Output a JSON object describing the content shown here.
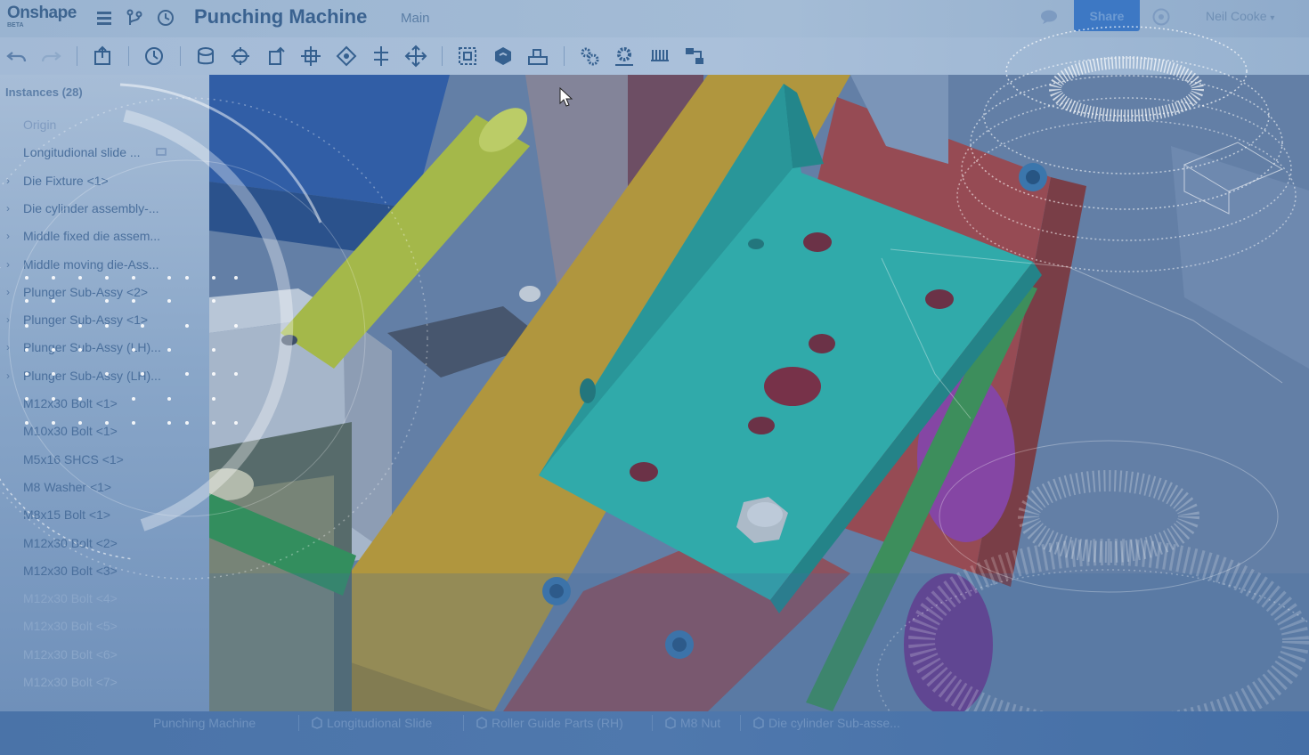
{
  "header": {
    "logo": "Onshape",
    "logo_badge": "BETA",
    "doc_title": "Punching Machine",
    "workspace": "Main",
    "share_label": "Share",
    "user_name": "Neil Cooke"
  },
  "toolbar": {
    "buttons": [
      {
        "icon": "undo-icon"
      },
      {
        "icon": "redo-icon"
      },
      {
        "icon": "export-icon"
      },
      {
        "icon": "history-icon"
      },
      {
        "icon": "insert-part-icon"
      },
      {
        "icon": "fastened-mate-icon"
      },
      {
        "icon": "slider-mate-icon"
      },
      {
        "icon": "revolute-mate-icon"
      },
      {
        "icon": "planar-mate-icon"
      },
      {
        "icon": "cylindrical-mate-icon"
      },
      {
        "icon": "ball-mate-icon"
      },
      {
        "icon": "mate-connector-icon"
      },
      {
        "icon": "group-icon"
      },
      {
        "icon": "relation-icon"
      },
      {
        "icon": "settings-gear-icon"
      },
      {
        "icon": "gear-relation-icon"
      },
      {
        "icon": "rack-pinion-icon"
      },
      {
        "icon": "linear-pattern-icon"
      }
    ]
  },
  "instances": {
    "title": "Instances (28)",
    "items": [
      {
        "label": "Origin",
        "expandable": false
      },
      {
        "label": "Longitudional slide ...",
        "expandable": false
      },
      {
        "label": "Die Fixture <1>",
        "expandable": true
      },
      {
        "label": "Die cylinder assembly-...",
        "expandable": true
      },
      {
        "label": "Middle fixed die assem...",
        "expandable": true
      },
      {
        "label": "Middle moving die-Ass...",
        "expandable": true
      },
      {
        "label": "Plunger Sub-Assy <2>",
        "expandable": true
      },
      {
        "label": "Plunger Sub-Assy <1>",
        "expandable": true
      },
      {
        "label": "Plunger Sub-Assy (LH)...",
        "expandable": true
      },
      {
        "label": "Plunger Sub-Assy (LH)...",
        "expandable": true
      },
      {
        "label": "M12x30 Bolt <1>",
        "expandable": false
      },
      {
        "label": "M10x30 Bolt <1>",
        "expandable": false
      },
      {
        "label": "M5x16 SHCS <1>",
        "expandable": false
      },
      {
        "label": "M8 Washer <1>",
        "expandable": false
      },
      {
        "label": "M8x15 Bolt <1>",
        "expandable": false
      },
      {
        "label": "M12x30 Bolt <2>",
        "expandable": false
      },
      {
        "label": "M12x30 Bolt <3>",
        "expandable": false
      },
      {
        "label": "M12x30 Bolt <4>",
        "expandable": false
      },
      {
        "label": "M12x30 Bolt <5>",
        "expandable": false
      },
      {
        "label": "M12x30 Bolt <6>",
        "expandable": false
      },
      {
        "label": "M12x30 Bolt <7>",
        "expandable": false
      }
    ]
  },
  "tabs": [
    {
      "label": "Punching Machine",
      "icon": "assembly-tab-icon"
    },
    {
      "label": "Longitudional Slide",
      "icon": "part-tab-icon"
    },
    {
      "label": "Roller Guide Parts (RH)",
      "icon": "part-tab-icon"
    },
    {
      "label": "M8 Nut",
      "icon": "part-tab-icon"
    },
    {
      "label": "Die cylinder Sub-asse...",
      "icon": "part-tab-icon"
    }
  ],
  "colors": {
    "bracket": "#2ec9b8",
    "rod": "#d8e23a",
    "yellow_plate": "#d9a81c",
    "red_plate": "#b8403a",
    "blue_frame": "#2d5aa8",
    "green_strip": "#3aa050",
    "purple_roller": "#a03aa8",
    "overlay_tint": "#3f6aa0"
  }
}
